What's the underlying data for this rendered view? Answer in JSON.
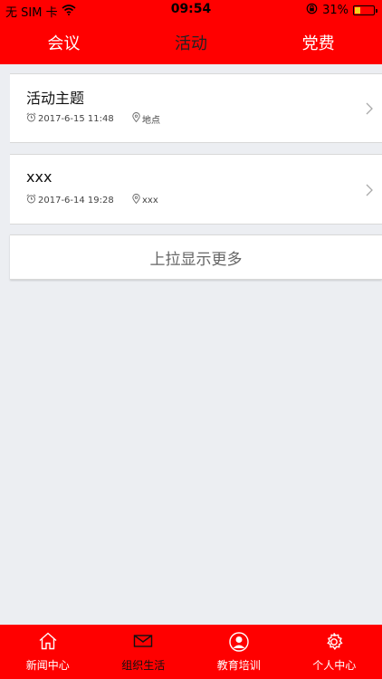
{
  "status_bar": {
    "carrier": "无 SIM 卡",
    "time": "09:54",
    "battery_percent": "31%",
    "battery_level": 0.31,
    "battery_color": "#f4d21c"
  },
  "header": {
    "background": "#ff0000",
    "tabs": [
      {
        "label": "会议",
        "active": false
      },
      {
        "label": "活动",
        "active": true
      },
      {
        "label": "党费",
        "active": false
      }
    ]
  },
  "activities": [
    {
      "title": "活动主题",
      "datetime": "2017-6-15 11:48",
      "location": "地点"
    },
    {
      "title": "xxx",
      "datetime": "2017-6-14 19:28",
      "location": "xxx"
    }
  ],
  "load_more_label": "上拉显示更多",
  "bottom_nav": {
    "items": [
      {
        "label": "新闻中心",
        "icon": "home-icon",
        "active": false
      },
      {
        "label": "组织生活",
        "icon": "mail-icon",
        "active": true
      },
      {
        "label": "教育培训",
        "icon": "user-circle-icon",
        "active": false
      },
      {
        "label": "个人中心",
        "icon": "gear-icon",
        "active": false
      }
    ]
  }
}
